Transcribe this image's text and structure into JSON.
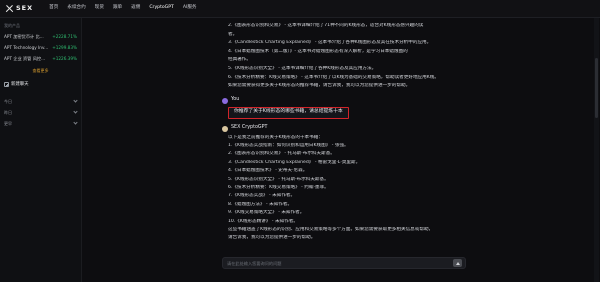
{
  "brand": {
    "name": "SEX"
  },
  "nav": [
    {
      "label": "首页"
    },
    {
      "label": "永续合约"
    },
    {
      "label": "现货"
    },
    {
      "label": "跟单"
    },
    {
      "label": "返佣"
    },
    {
      "label": "CryptoGPT",
      "badge": ""
    },
    {
      "label": "AI服务"
    }
  ],
  "sidebar": {
    "section_title": "我的产品",
    "pairs": [
      {
        "name": "APT 加密货币计 比...",
        "change": "+2228.71%"
      },
      {
        "name": "APT Technology Inv...",
        "change": "+1299.83%"
      },
      {
        "name": "APT 企业 资管 风控...",
        "change": "+1226.39%"
      }
    ],
    "more_label": "查看更多",
    "new_chat_label": "新建聊天",
    "history": [
      {
        "label": "今日"
      },
      {
        "label": "昨日"
      },
      {
        "label": "更早"
      }
    ]
  },
  "conversation": {
    "previous_reply_lines": [
      "2.《图表形态识别和交易》 - 这本书详细介绍了71种不同的K线形态，适合对K线形态感兴趣的读",
      "者。",
      "3.《Candlestick Charting Explained》 - 这本书介绍了各种K线图形态及其在技术分析中的应用。",
      "4.《日本蜡烛图技术（第二版）》- 这本书对蜡烛图形态有深入解析，是学习日本蜡烛图的",
      "经典著作。",
      "5.《K线形态识别大全》 - 这本书详细介绍了各种K线形态及其应用方法。",
      "6.《技术分析精要：K线交易策略》 - 这本书介绍了以K线为基础的交易策略，帮助读者更好地应用K线。",
      "如果您需要获得更多关于K线形态的推荐书籍，请告诉我，我可以为您提供进一步的帮助。"
    ],
    "user_name": "You",
    "user_message": "你推荐了关于K线形态的哪些书籍，请总结提炼十本",
    "bot_name": "SEX CryptoGPT",
    "reply_lines": [
      "以下是我之前推荐的关于K线形态的十本书籍：",
      "1.《K线形态实战指南：如何识别和运用日K线图》 - 张强。",
      "2.《图表形态识别和交易》 - 托马斯·布尔科夫斯基。",
      "3.《Candlestick Charting Explained》 - 格雷戈里·L·莫里斯。",
      "4.《日本蜡烛图技术》 - 史蒂夫·尼森。",
      "5.《K线形态识别大全》 - 托马斯·布尔科夫斯基。",
      "6.《技术分析精要：K线交易策略》 - 约翰·墨菲。",
      "7.《K线形态实战》 - 未知作者。",
      "8.《蜡烛图方法》 - 未知作者。",
      "9.《K线交易策略大全》 - 未知作者。",
      "10.《K线形态精讲》 - 未知作者。",
      "这些书籍涵盖了K线形态的识别、应用和交易策略等多个方面。如果您需要获取更多相关信息或帮助，",
      "请告诉我，我可以为您提供进一步的帮助。"
    ]
  },
  "input": {
    "placeholder": "请在此处输入您要询问的问题"
  }
}
